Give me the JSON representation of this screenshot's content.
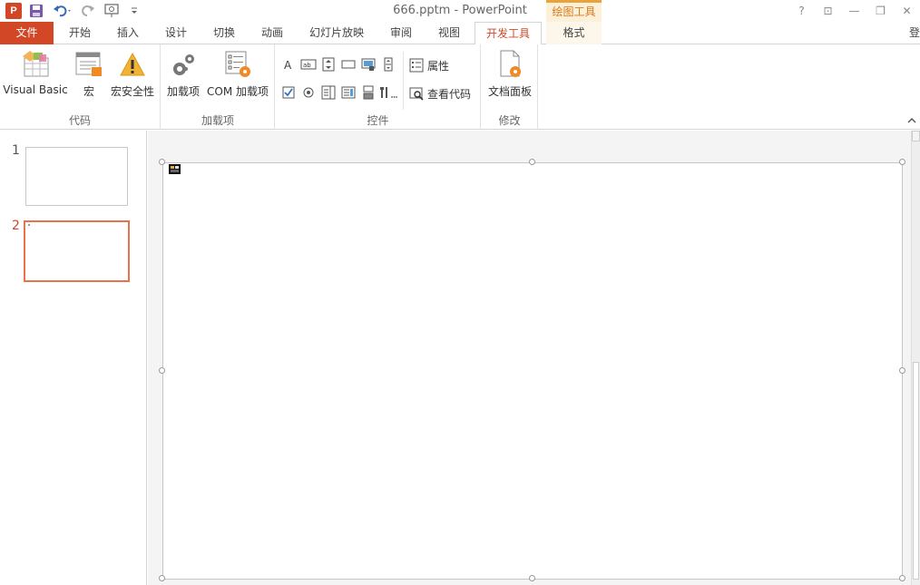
{
  "app": {
    "window_title": "666.pptm - PowerPoint",
    "context_tab_group": "绘图工具",
    "signin_text": "登"
  },
  "window_controls": {
    "help": "?",
    "ribbon_display": "⊡",
    "minimize": "—",
    "restore": "❐",
    "close": "✕"
  },
  "tabs": [
    {
      "label": "文件"
    },
    {
      "label": "开始"
    },
    {
      "label": "插入"
    },
    {
      "label": "设计"
    },
    {
      "label": "切换"
    },
    {
      "label": "动画"
    },
    {
      "label": "幻灯片放映"
    },
    {
      "label": "审阅"
    },
    {
      "label": "视图"
    },
    {
      "label": "开发工具"
    },
    {
      "label": "格式"
    }
  ],
  "ribbon": {
    "code": {
      "label": "代码",
      "visual_basic": "Visual Basic",
      "macro": "宏",
      "macro_security": "宏安全性"
    },
    "addins": {
      "label": "加载项",
      "addins_btn": "加载项",
      "com_addins": "COM 加载项"
    },
    "controls": {
      "label": "控件",
      "properties": "属性",
      "view_code": "查看代码"
    },
    "modify": {
      "label": "修改",
      "document_panel": "文档面板"
    }
  },
  "thumbnails": [
    {
      "number": "1",
      "selected": false
    },
    {
      "number": "2",
      "selected": true
    }
  ],
  "colors": {
    "accent": "#d24726",
    "context_accent": "#e8a33d"
  }
}
